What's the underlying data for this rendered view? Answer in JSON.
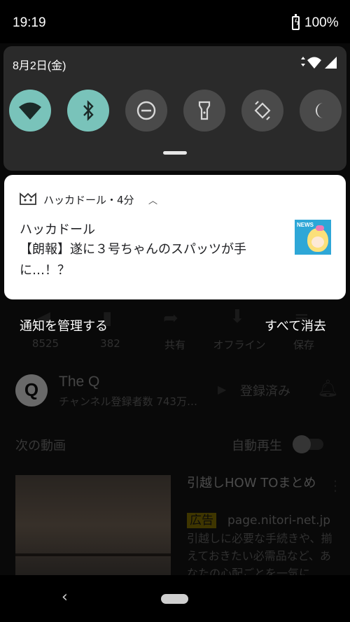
{
  "status_bar": {
    "time": "19:19",
    "battery": "100%"
  },
  "quick_settings": {
    "date": "8月2日(金)",
    "tiles": [
      {
        "icon": "wifi-icon",
        "state": "on"
      },
      {
        "icon": "bluetooth-icon",
        "state": "on"
      },
      {
        "icon": "do-not-disturb-icon",
        "state": "off"
      },
      {
        "icon": "flashlight-icon",
        "state": "off"
      },
      {
        "icon": "auto-rotate-icon",
        "state": "off"
      },
      {
        "icon": "night-light-icon",
        "state": "off"
      }
    ]
  },
  "notification": {
    "app_header": "ハッカドール・4分",
    "title": "ハッカドール",
    "body": "【朗報】遂に３号ちゃんのスパッツが手に…！？",
    "thumb_label": "NEWS"
  },
  "shade_actions": {
    "manage": "通知を管理する",
    "clear_all": "すべて消去"
  },
  "background_app": {
    "likes": "8525",
    "dislikes": "382",
    "share": "共有",
    "offline": "オフライン",
    "save": "保存",
    "channel_logo": "Q",
    "channel_name": "The Q",
    "subscribers": "チャンネル登録者数 743万…",
    "subscribed": "登録済み",
    "up_next": "次の動画",
    "autoplay": "自動再生",
    "ad_title": "引越しHOW TOまとめ",
    "ad_badge": "広告",
    "ad_domain": "page.nitori-net.jp",
    "ad_desc": "引越しに必要な手続きや、揃えておきたい必需品など、あなたの心配ごとを一気に"
  },
  "colors": {
    "tile_on": "#79c3ba",
    "tile_off": "#4a4a4a",
    "panel": "#2a2a2a"
  }
}
